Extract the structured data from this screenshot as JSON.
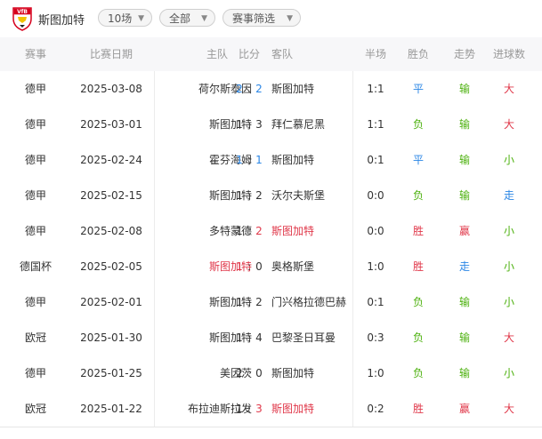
{
  "header": {
    "team_name": "斯图加特",
    "filters": {
      "count_label": "10场",
      "type_label": "全部",
      "filter_label": "赛事筛选"
    }
  },
  "columns": {
    "competition": "赛事",
    "date": "比赛日期",
    "home": "主队",
    "score": "比分",
    "away": "客队",
    "half": "半场",
    "result": "胜负",
    "trend": "走势",
    "goals": "进球数"
  },
  "colors": {
    "highlight": "#e0384a",
    "blue": "#2a86e6",
    "green": "#4db10f",
    "lose": "#4db10f",
    "win": "#e0384a",
    "draw": "#2a86e6",
    "big": "#e0384a",
    "small": "#4db10f",
    "walk": "#2a86e6"
  },
  "matches": [
    {
      "competition": "德甲",
      "date": "2025-03-08",
      "home": "荷尔斯泰因",
      "home_score": "2",
      "away_score": "2",
      "away": "斯图加特",
      "half": "1:1",
      "result": "平",
      "trend": "输",
      "goals": "大",
      "team_side": "away",
      "score_color": "blue"
    },
    {
      "competition": "德甲",
      "date": "2025-03-01",
      "home": "斯图加特",
      "home_score": "1",
      "away_score": "3",
      "away": "拜仁慕尼黑",
      "half": "1:1",
      "result": "负",
      "trend": "输",
      "goals": "大",
      "team_side": "home",
      "score_color": "none"
    },
    {
      "competition": "德甲",
      "date": "2025-02-24",
      "home": "霍芬海姆",
      "home_score": "1",
      "away_score": "1",
      "away": "斯图加特",
      "half": "0:1",
      "result": "平",
      "trend": "输",
      "goals": "小",
      "team_side": "away",
      "score_color": "blue"
    },
    {
      "competition": "德甲",
      "date": "2025-02-15",
      "home": "斯图加特",
      "home_score": "1",
      "away_score": "2",
      "away": "沃尔夫斯堡",
      "half": "0:0",
      "result": "负",
      "trend": "输",
      "goals": "走",
      "team_side": "home",
      "score_color": "none"
    },
    {
      "competition": "德甲",
      "date": "2025-02-08",
      "home": "多特蒙德",
      "home_score": "1",
      "away_score": "2",
      "away": "斯图加特",
      "half": "0:0",
      "result": "胜",
      "trend": "赢",
      "goals": "小",
      "team_side": "away",
      "score_color": "red"
    },
    {
      "competition": "德国杯",
      "date": "2025-02-05",
      "home": "斯图加特",
      "home_score": "1",
      "away_score": "0",
      "away": "奥格斯堡",
      "half": "1:0",
      "result": "胜",
      "trend": "走",
      "goals": "小",
      "team_side": "home",
      "score_color": "red"
    },
    {
      "competition": "德甲",
      "date": "2025-02-01",
      "home": "斯图加特",
      "home_score": "1",
      "away_score": "2",
      "away": "门兴格拉德巴赫",
      "half": "0:1",
      "result": "负",
      "trend": "输",
      "goals": "小",
      "team_side": "home",
      "score_color": "none"
    },
    {
      "competition": "欧冠",
      "date": "2025-01-30",
      "home": "斯图加特",
      "home_score": "1",
      "away_score": "4",
      "away": "巴黎圣日耳曼",
      "half": "0:3",
      "result": "负",
      "trend": "输",
      "goals": "大",
      "team_side": "home",
      "score_color": "none"
    },
    {
      "competition": "德甲",
      "date": "2025-01-25",
      "home": "美因茨",
      "home_score": "2",
      "away_score": "0",
      "away": "斯图加特",
      "half": "1:0",
      "result": "负",
      "trend": "输",
      "goals": "小",
      "team_side": "away",
      "score_color": "none"
    },
    {
      "competition": "欧冠",
      "date": "2025-01-22",
      "home": "布拉迪斯拉发",
      "home_score": "1",
      "away_score": "3",
      "away": "斯图加特",
      "half": "0:2",
      "result": "胜",
      "trend": "赢",
      "goals": "大",
      "team_side": "away",
      "score_color": "red"
    }
  ]
}
